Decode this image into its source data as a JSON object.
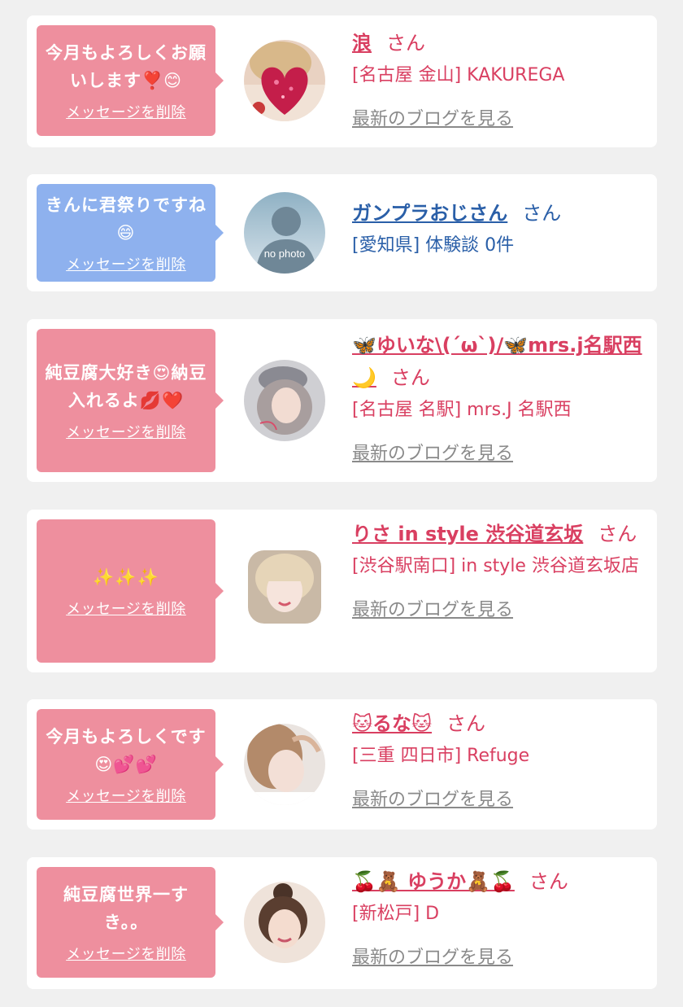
{
  "delete_label": "メッセージを削除",
  "blog_label": "最新のブログを見る",
  "suffix": "さん",
  "colors": {
    "pink_bubble": "#ee8f9e",
    "blue_bubble": "#8eb1ee",
    "name_red": "#d93f61",
    "name_blue": "#2a5fa8",
    "blog_gray": "#8a8a8a"
  },
  "cards": [
    {
      "bubble_color": "pink",
      "message": "今月もよろしくお願いします❣️😊",
      "avatar": "avatar-heart-photo",
      "name": "浪",
      "shop": "[名古屋 金山] KAKUREGA",
      "has_blog": true
    },
    {
      "bubble_color": "blue",
      "message": "きんに君祭りですね😄",
      "avatar": "no-photo",
      "avatar_text": "no photo",
      "name": "ガンプラおじさん",
      "shop": "[愛知県] 体験談 0件",
      "has_blog": false
    },
    {
      "bubble_color": "pink",
      "message": "純豆腐大好き😍納豆入れるよ💋❤️",
      "avatar": "avatar-girl-hat",
      "name": "🦋ゆいな\\(´ω`)/🦋mrs.j名駅西🌙",
      "shop": "[名古屋 名駅] mrs.J 名駅西",
      "has_blog": true
    },
    {
      "bubble_color": "pink",
      "message": "✨✨✨",
      "avatar": "avatar-girl-blonde",
      "name": "りさ in style 渋谷道玄坂",
      "shop": "[渋谷駅南口] in style 渋谷道玄坂店",
      "has_blog": true
    },
    {
      "bubble_color": "pink",
      "message": "今月もよろしくです😍💕💕",
      "avatar": "avatar-girl-brown",
      "name": "🐱るな🐱",
      "shop": "[三重 四日市] Refuge",
      "has_blog": true
    },
    {
      "bubble_color": "pink",
      "message": "純豆腐世界一すき。。",
      "avatar": "avatar-girl-bun",
      "name": "🍒🧸 ゆうか🧸🍒",
      "shop": "[新松戸] D",
      "has_blog": true
    }
  ]
}
